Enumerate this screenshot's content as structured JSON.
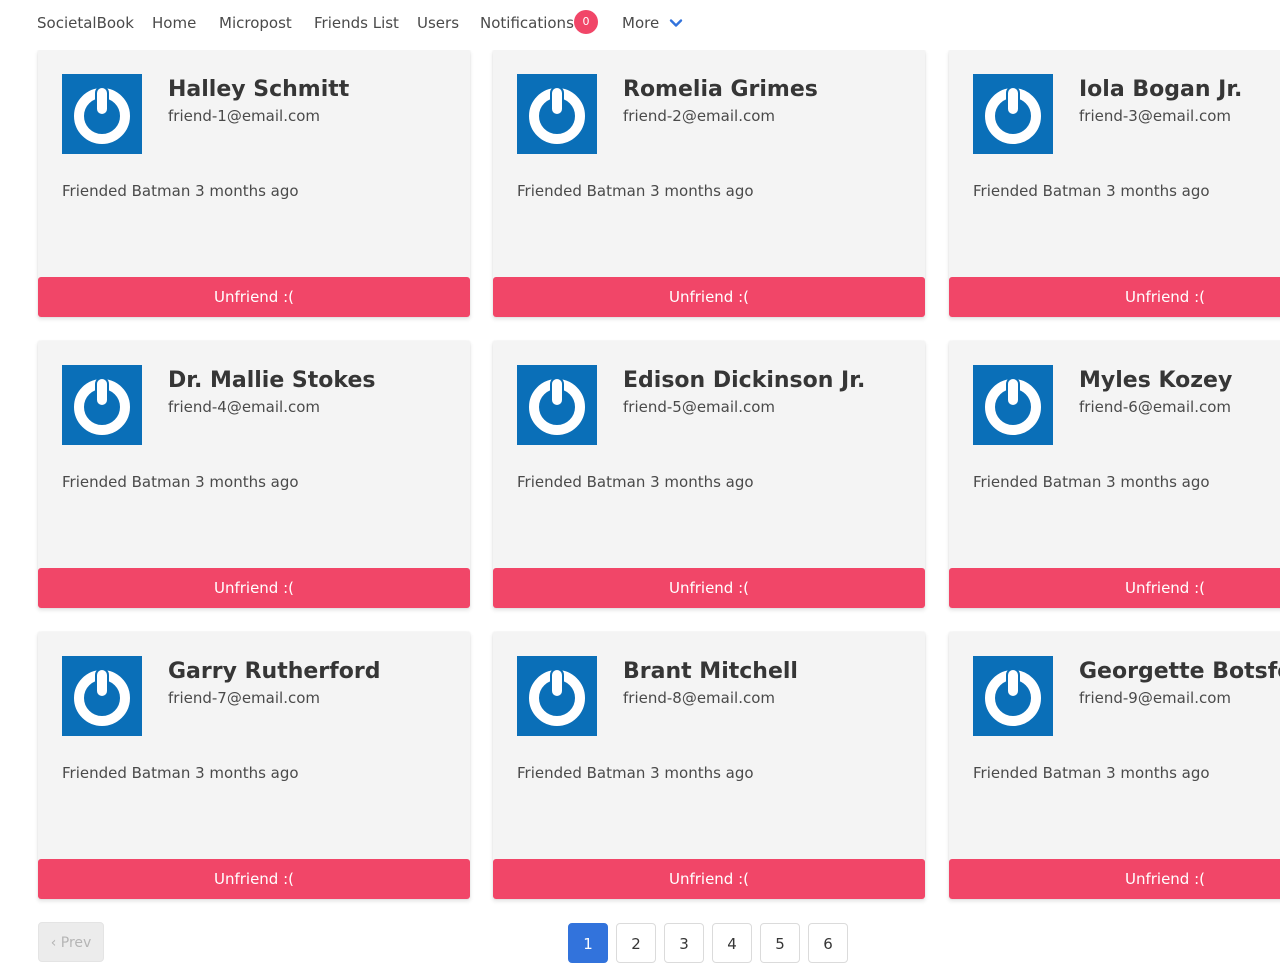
{
  "nav": {
    "brand": "SocietalBook",
    "home": "Home",
    "micropost": "Micropost",
    "friends_list": "Friends List",
    "users": "Users",
    "notifications": "Notifications",
    "notifications_count": "0",
    "more": "More",
    "more_icon": "chevron-down-icon"
  },
  "friends": [
    {
      "name": "Halley Schmitt",
      "email": "friend-1@email.com",
      "status": "Friended Batman 3 months ago",
      "action": "Unfriend :("
    },
    {
      "name": "Romelia Grimes",
      "email": "friend-2@email.com",
      "status": "Friended Batman 3 months ago",
      "action": "Unfriend :("
    },
    {
      "name": "Iola Bogan Jr.",
      "email": "friend-3@email.com",
      "status": "Friended Batman 3 months ago",
      "action": "Unfriend :("
    },
    {
      "name": "Dr. Mallie Stokes",
      "email": "friend-4@email.com",
      "status": "Friended Batman 3 months ago",
      "action": "Unfriend :("
    },
    {
      "name": "Edison Dickinson Jr.",
      "email": "friend-5@email.com",
      "status": "Friended Batman 3 months ago",
      "action": "Unfriend :("
    },
    {
      "name": "Myles Kozey",
      "email": "friend-6@email.com",
      "status": "Friended Batman 3 months ago",
      "action": "Unfriend :("
    },
    {
      "name": "Garry Rutherford",
      "email": "friend-7@email.com",
      "status": "Friended Batman 3 months ago",
      "action": "Unfriend :("
    },
    {
      "name": "Brant Mitchell",
      "email": "friend-8@email.com",
      "status": "Friended Batman 3 months ago",
      "action": "Unfriend :("
    },
    {
      "name": "Georgette Botsford",
      "email": "friend-9@email.com",
      "status": "Friended Batman 3 months ago",
      "action": "Unfriend :("
    }
  ],
  "avatar_icon": "power-icon",
  "colors": {
    "avatar_bg": "#0a6fb8",
    "danger": "#f14668",
    "primary": "#3273dc",
    "card_bg": "#f4f4f4"
  },
  "pagination": {
    "prev": "‹ Prev",
    "pages": [
      "1",
      "2",
      "3",
      "4",
      "5",
      "6"
    ],
    "current": "1"
  }
}
